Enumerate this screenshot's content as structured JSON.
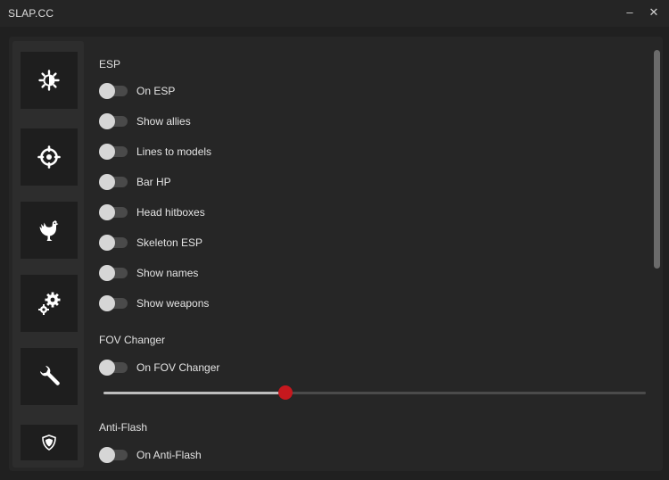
{
  "window": {
    "title": "SLAP.CC",
    "minimize": "–",
    "close": "✕"
  },
  "sidebar": {
    "items": [
      {
        "icon": "brightness-icon"
      },
      {
        "icon": "crosshair-icon"
      },
      {
        "icon": "chicken-icon"
      },
      {
        "icon": "gears-icon"
      },
      {
        "icon": "wrench-icon"
      },
      {
        "icon": "shield-icon"
      }
    ]
  },
  "esp": {
    "title": "ESP",
    "toggles": [
      {
        "label": "On ESP",
        "on": false
      },
      {
        "label": "Show allies",
        "on": false
      },
      {
        "label": "Lines to models",
        "on": false
      },
      {
        "label": "Bar HP",
        "on": false
      },
      {
        "label": "Head hitboxes",
        "on": false
      },
      {
        "label": "Skeleton ESP",
        "on": false
      },
      {
        "label": "Show names",
        "on": false
      },
      {
        "label": "Show weapons",
        "on": false
      }
    ]
  },
  "fov": {
    "title": "FOV Changer",
    "toggle": {
      "label": "On FOV Changer",
      "on": false
    },
    "slider": {
      "fraction": 0.335,
      "accent": "#c6181e"
    }
  },
  "antiflash": {
    "title": "Anti-Flash",
    "toggle": {
      "label": "On Anti-Flash",
      "on": false
    }
  }
}
